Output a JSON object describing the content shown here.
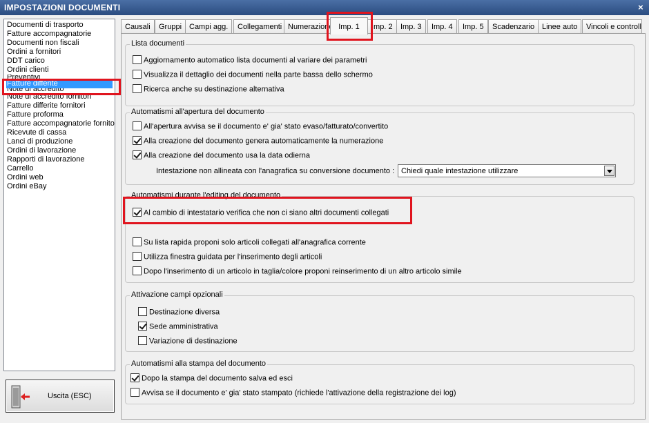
{
  "window": {
    "title": "IMPOSTAZIONI DOCUMENTI",
    "close_label": "×"
  },
  "sidebar": {
    "items": [
      "Documenti di trasporto",
      "Fatture accompagnatorie",
      "Documenti non fiscali",
      "Ordini a fornitori",
      "DDT carico",
      "Ordini clienti",
      "Preventivi",
      "Fatture differite",
      "Note di accredito",
      "Note di accredito fornitori",
      "Fatture differite fornitori",
      "Fatture proforma",
      "Fatture accompagnatorie fornito",
      "Ricevute di cassa",
      "Lanci di produzione",
      "Ordini di lavorazione",
      "Rapporti di lavorazione",
      "Carrello",
      "Ordini web",
      "Ordini eBay"
    ],
    "selected": "Fatture differite",
    "exit_label": "Uscita (ESC)"
  },
  "tabs": [
    "Causali",
    "Gruppi",
    "Campi agg.",
    "Collegamenti",
    "Numerazione",
    "Imp. 1",
    "Imp. 2",
    "Imp. 3",
    "Imp. 4",
    "Imp. 5",
    "Scadenzario",
    "Linee auto",
    "Vincoli e controlli"
  ],
  "active_tab": "Imp. 1",
  "groups": {
    "lista": {
      "title": "Lista documenti",
      "options": [
        {
          "label": "Aggiornamento automatico lista documenti al variare dei parametri",
          "checked": false
        },
        {
          "label": "Visualizza il dettaglio dei documenti nella parte bassa dello schermo",
          "checked": false
        },
        {
          "label": "Ricerca anche su destinazione alternativa",
          "checked": false
        }
      ]
    },
    "apertura": {
      "title": "Automatismi all'apertura del documento",
      "options": [
        {
          "label": "All'apertura avvisa se il documento e' gia' stato evaso/fatturato/convertito",
          "checked": false
        },
        {
          "label": "Alla creazione del documento genera automaticamente la numerazione",
          "checked": true
        },
        {
          "label": "Alla creazione del documento usa la data odierna",
          "checked": true
        }
      ],
      "header_label": "Intestazione non allineata con l'anagrafica su conversione documento :",
      "header_value": "Chiedi quale intestazione utilizzare"
    },
    "editing": {
      "title": "Automatismi durante l'editing del documento",
      "options": [
        {
          "label": "Al cambio di intestatario verifica che non ci siano altri documenti collegati",
          "checked": true
        },
        {
          "label": "Su lista rapida proponi solo articoli collegati all'anagrafica corrente",
          "checked": false
        },
        {
          "label": "Utilizza finestra guidata per l'inserimento degli articoli",
          "checked": false
        },
        {
          "label": "Dopo l'inserimento di un articolo in taglia/colore proponi reinserimento di un altro articolo simile",
          "checked": false
        }
      ]
    },
    "campi": {
      "title": "Attivazione campi opzionali",
      "options": [
        {
          "label": "Destinazione diversa",
          "checked": false
        },
        {
          "label": "Sede amministrativa",
          "checked": true
        },
        {
          "label": "Variazione di destinazione",
          "checked": false
        }
      ]
    },
    "stampa": {
      "title": "Automatismi alla stampa del documento",
      "options": [
        {
          "label": "Dopo la stampa del documento salva ed esci",
          "checked": true
        },
        {
          "label": "Avvisa se il documento e' gia' stato stampato (richiede l'attivazione della registrazione dei log)",
          "checked": false
        }
      ]
    }
  }
}
